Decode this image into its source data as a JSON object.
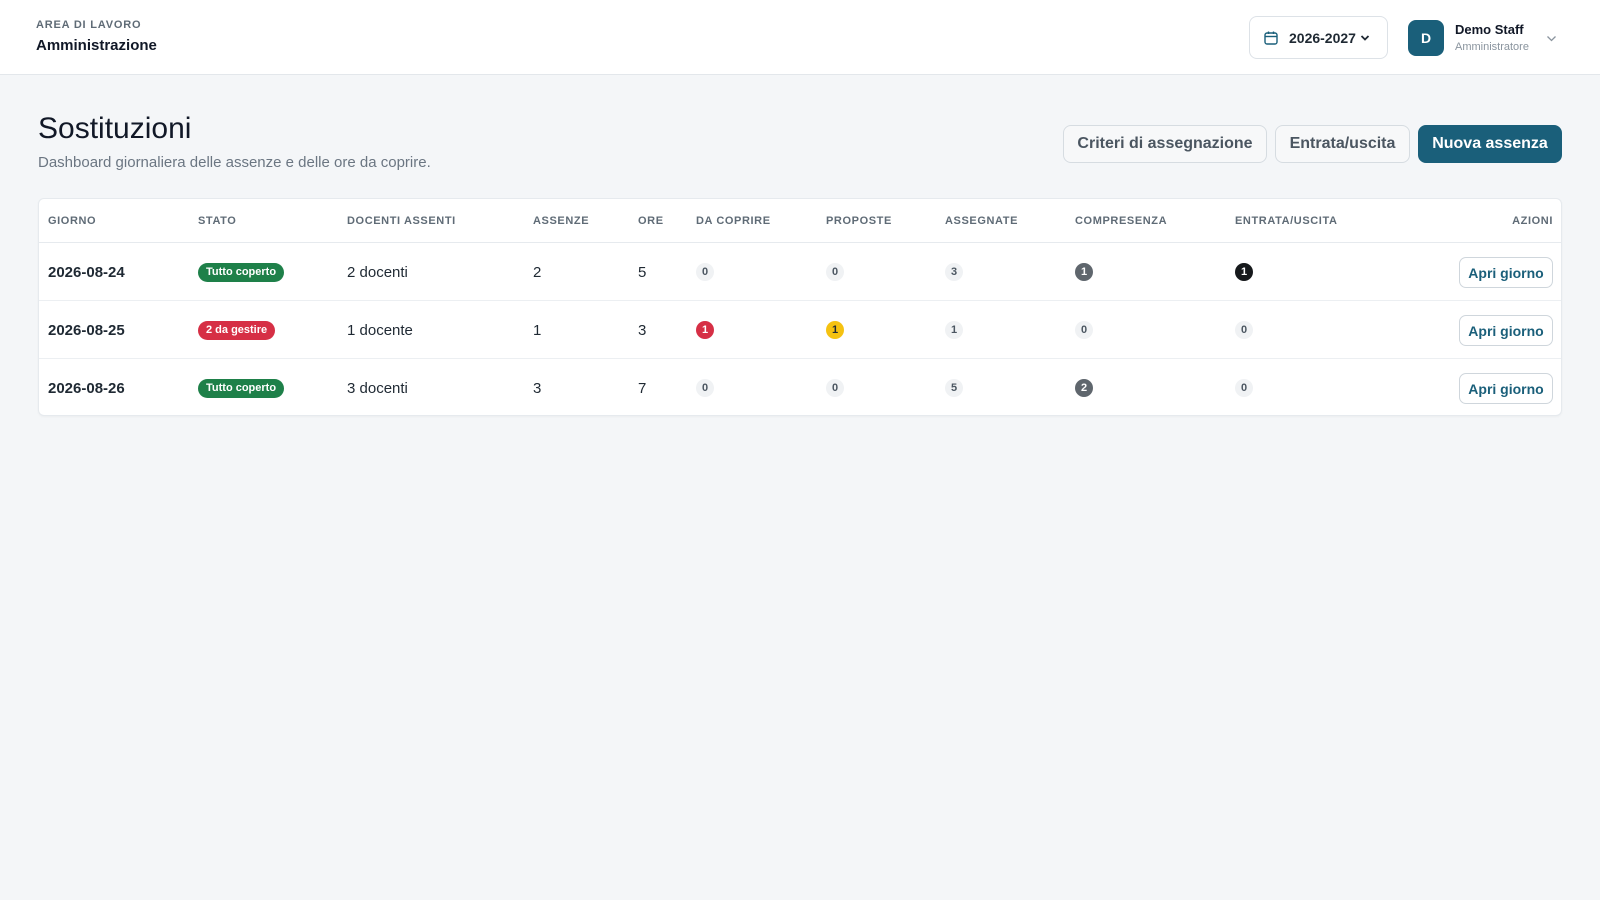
{
  "header": {
    "workspace_label": "AREA DI LAVORO",
    "workspace_name": "Amministrazione",
    "year": "2026-2027",
    "user": {
      "initial": "D",
      "name": "Demo Staff",
      "role": "Amministratore"
    }
  },
  "page": {
    "title": "Sostituzioni",
    "subtitle": "Dashboard giornaliera delle assenze e delle ore da coprire.",
    "buttons": {
      "criteria": "Criteri di assegnazione",
      "entry_exit": "Entrata/uscita",
      "new_absence": "Nuova assenza"
    }
  },
  "table": {
    "columns": [
      "GIORNO",
      "STATO",
      "DOCENTI ASSENTI",
      "ASSENZE",
      "ORE",
      "DA COPRIRE",
      "PROPOSTE",
      "ASSEGNATE",
      "COMPRESENZA",
      "ENTRATA/USCITA",
      "AZIONI"
    ],
    "action_label": "Apri giorno",
    "rows": [
      {
        "day": "2026-08-24",
        "status": "Tutto coperto",
        "status_tone": "success",
        "teachers": "2 docenti",
        "absences": "2",
        "hours": "5",
        "to_cover": "0",
        "proposed": "0",
        "assigned": "3",
        "co_presence": "1",
        "entry_exit": "1"
      },
      {
        "day": "2026-08-25",
        "status": "2 da gestire",
        "status_tone": "danger",
        "teachers": "1 docente",
        "absences": "1",
        "hours": "3",
        "to_cover": "1",
        "proposed": "1",
        "assigned": "1",
        "co_presence": "0",
        "entry_exit": "0"
      },
      {
        "day": "2026-08-26",
        "status": "Tutto coperto",
        "status_tone": "success",
        "teachers": "3 docenti",
        "absences": "3",
        "hours": "7",
        "to_cover": "0",
        "proposed": "0",
        "assigned": "5",
        "co_presence": "2",
        "entry_exit": "0"
      }
    ]
  },
  "colors": {
    "primary": "#1a5f7a",
    "success": "#1e8049",
    "danger": "#d62f45",
    "warning": "#f5c211",
    "neutral_badge": "#f0f2f4",
    "dark_gray": "#5f666d",
    "black": "#16191c"
  },
  "icons": {
    "year_picker": "calendar-icon",
    "dropdown": "chevron-down-icon"
  }
}
